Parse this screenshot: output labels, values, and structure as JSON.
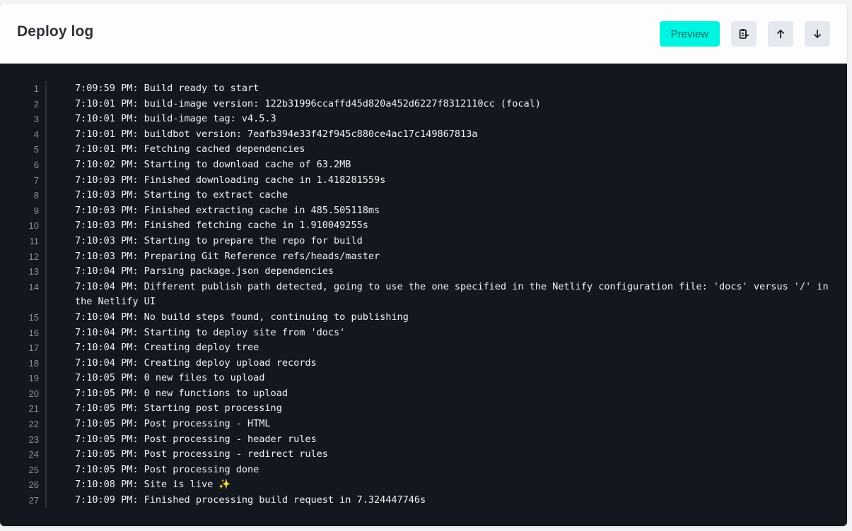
{
  "header": {
    "title": "Deploy log",
    "preview_label": "Preview",
    "buttons": [
      {
        "name": "copy-to-clipboard",
        "icon": "clipboard-copy-icon"
      },
      {
        "name": "scroll-to-top",
        "icon": "arrow-up-icon"
      },
      {
        "name": "scroll-to-bottom",
        "icon": "arrow-down-icon"
      }
    ]
  },
  "colors": {
    "preview_bg": "#00f5e0",
    "log_bg": "#131820",
    "log_text": "#f0f1f3",
    "line_number": "#8a9099"
  },
  "log": {
    "lines": [
      {
        "n": "1",
        "text": "7:09:59 PM: Build ready to start"
      },
      {
        "n": "2",
        "text": "7:10:01 PM: build-image version: 122b31996ccaffd45d820a452d6227f8312110cc (focal)"
      },
      {
        "n": "3",
        "text": "7:10:01 PM: build-image tag: v4.5.3"
      },
      {
        "n": "4",
        "text": "7:10:01 PM: buildbot version: 7eafb394e33f42f945c880ce4ac17c149867813a"
      },
      {
        "n": "5",
        "text": "7:10:01 PM: Fetching cached dependencies"
      },
      {
        "n": "6",
        "text": "7:10:02 PM: Starting to download cache of 63.2MB"
      },
      {
        "n": "7",
        "text": "7:10:03 PM: Finished downloading cache in 1.418281559s"
      },
      {
        "n": "8",
        "text": "7:10:03 PM: Starting to extract cache"
      },
      {
        "n": "9",
        "text": "7:10:03 PM: Finished extracting cache in 485.505118ms"
      },
      {
        "n": "10",
        "text": "7:10:03 PM: Finished fetching cache in 1.910049255s"
      },
      {
        "n": "11",
        "text": "7:10:03 PM: Starting to prepare the repo for build"
      },
      {
        "n": "12",
        "text": "7:10:03 PM: Preparing Git Reference refs/heads/master"
      },
      {
        "n": "13",
        "text": "7:10:04 PM: Parsing package.json dependencies"
      },
      {
        "n": "14",
        "text": "7:10:04 PM: Different publish path detected, going to use the one specified in the Netlify configuration file: 'docs' versus '/' in the Netlify UI"
      },
      {
        "n": "15",
        "text": "7:10:04 PM: No build steps found, continuing to publishing"
      },
      {
        "n": "16",
        "text": "7:10:04 PM: Starting to deploy site from 'docs'"
      },
      {
        "n": "17",
        "text": "7:10:04 PM: Creating deploy tree"
      },
      {
        "n": "18",
        "text": "7:10:04 PM: Creating deploy upload records"
      },
      {
        "n": "19",
        "text": "7:10:05 PM: 0 new files to upload"
      },
      {
        "n": "20",
        "text": "7:10:05 PM: 0 new functions to upload"
      },
      {
        "n": "21",
        "text": "7:10:05 PM: Starting post processing"
      },
      {
        "n": "22",
        "text": "7:10:05 PM: Post processing - HTML"
      },
      {
        "n": "23",
        "text": "7:10:05 PM: Post processing - header rules"
      },
      {
        "n": "24",
        "text": "7:10:05 PM: Post processing - redirect rules"
      },
      {
        "n": "25",
        "text": "7:10:05 PM: Post processing done"
      },
      {
        "n": "26",
        "text": "7:10:08 PM: Site is live ✨"
      },
      {
        "n": "27",
        "text": "7:10:09 PM: Finished processing build request in 7.324447746s"
      }
    ]
  }
}
